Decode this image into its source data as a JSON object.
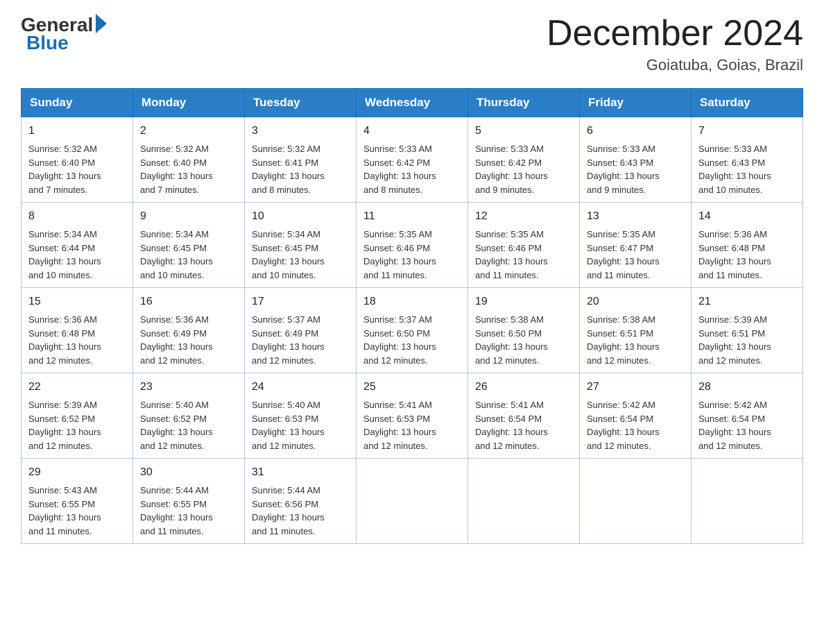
{
  "header": {
    "logo": {
      "general": "General",
      "blue": "Blue"
    },
    "title": "December 2024",
    "location": "Goiatuba, Goias, Brazil"
  },
  "calendar": {
    "days_of_week": [
      "Sunday",
      "Monday",
      "Tuesday",
      "Wednesday",
      "Thursday",
      "Friday",
      "Saturday"
    ],
    "weeks": [
      [
        {
          "day": "1",
          "sunrise": "5:32 AM",
          "sunset": "6:40 PM",
          "daylight": "13 hours and 7 minutes."
        },
        {
          "day": "2",
          "sunrise": "5:32 AM",
          "sunset": "6:40 PM",
          "daylight": "13 hours and 7 minutes."
        },
        {
          "day": "3",
          "sunrise": "5:32 AM",
          "sunset": "6:41 PM",
          "daylight": "13 hours and 8 minutes."
        },
        {
          "day": "4",
          "sunrise": "5:33 AM",
          "sunset": "6:42 PM",
          "daylight": "13 hours and 8 minutes."
        },
        {
          "day": "5",
          "sunrise": "5:33 AM",
          "sunset": "6:42 PM",
          "daylight": "13 hours and 9 minutes."
        },
        {
          "day": "6",
          "sunrise": "5:33 AM",
          "sunset": "6:43 PM",
          "daylight": "13 hours and 9 minutes."
        },
        {
          "day": "7",
          "sunrise": "5:33 AM",
          "sunset": "6:43 PM",
          "daylight": "13 hours and 10 minutes."
        }
      ],
      [
        {
          "day": "8",
          "sunrise": "5:34 AM",
          "sunset": "6:44 PM",
          "daylight": "13 hours and 10 minutes."
        },
        {
          "day": "9",
          "sunrise": "5:34 AM",
          "sunset": "6:45 PM",
          "daylight": "13 hours and 10 minutes."
        },
        {
          "day": "10",
          "sunrise": "5:34 AM",
          "sunset": "6:45 PM",
          "daylight": "13 hours and 10 minutes."
        },
        {
          "day": "11",
          "sunrise": "5:35 AM",
          "sunset": "6:46 PM",
          "daylight": "13 hours and 11 minutes."
        },
        {
          "day": "12",
          "sunrise": "5:35 AM",
          "sunset": "6:46 PM",
          "daylight": "13 hours and 11 minutes."
        },
        {
          "day": "13",
          "sunrise": "5:35 AM",
          "sunset": "6:47 PM",
          "daylight": "13 hours and 11 minutes."
        },
        {
          "day": "14",
          "sunrise": "5:36 AM",
          "sunset": "6:48 PM",
          "daylight": "13 hours and 11 minutes."
        }
      ],
      [
        {
          "day": "15",
          "sunrise": "5:36 AM",
          "sunset": "6:48 PM",
          "daylight": "13 hours and 12 minutes."
        },
        {
          "day": "16",
          "sunrise": "5:36 AM",
          "sunset": "6:49 PM",
          "daylight": "13 hours and 12 minutes."
        },
        {
          "day": "17",
          "sunrise": "5:37 AM",
          "sunset": "6:49 PM",
          "daylight": "13 hours and 12 minutes."
        },
        {
          "day": "18",
          "sunrise": "5:37 AM",
          "sunset": "6:50 PM",
          "daylight": "13 hours and 12 minutes."
        },
        {
          "day": "19",
          "sunrise": "5:38 AM",
          "sunset": "6:50 PM",
          "daylight": "13 hours and 12 minutes."
        },
        {
          "day": "20",
          "sunrise": "5:38 AM",
          "sunset": "6:51 PM",
          "daylight": "13 hours and 12 minutes."
        },
        {
          "day": "21",
          "sunrise": "5:39 AM",
          "sunset": "6:51 PM",
          "daylight": "13 hours and 12 minutes."
        }
      ],
      [
        {
          "day": "22",
          "sunrise": "5:39 AM",
          "sunset": "6:52 PM",
          "daylight": "13 hours and 12 minutes."
        },
        {
          "day": "23",
          "sunrise": "5:40 AM",
          "sunset": "6:52 PM",
          "daylight": "13 hours and 12 minutes."
        },
        {
          "day": "24",
          "sunrise": "5:40 AM",
          "sunset": "6:53 PM",
          "daylight": "13 hours and 12 minutes."
        },
        {
          "day": "25",
          "sunrise": "5:41 AM",
          "sunset": "6:53 PM",
          "daylight": "13 hours and 12 minutes."
        },
        {
          "day": "26",
          "sunrise": "5:41 AM",
          "sunset": "6:54 PM",
          "daylight": "13 hours and 12 minutes."
        },
        {
          "day": "27",
          "sunrise": "5:42 AM",
          "sunset": "6:54 PM",
          "daylight": "13 hours and 12 minutes."
        },
        {
          "day": "28",
          "sunrise": "5:42 AM",
          "sunset": "6:54 PM",
          "daylight": "13 hours and 12 minutes."
        }
      ],
      [
        {
          "day": "29",
          "sunrise": "5:43 AM",
          "sunset": "6:55 PM",
          "daylight": "13 hours and 11 minutes."
        },
        {
          "day": "30",
          "sunrise": "5:44 AM",
          "sunset": "6:55 PM",
          "daylight": "13 hours and 11 minutes."
        },
        {
          "day": "31",
          "sunrise": "5:44 AM",
          "sunset": "6:56 PM",
          "daylight": "13 hours and 11 minutes."
        },
        null,
        null,
        null,
        null
      ]
    ],
    "labels": {
      "sunrise": "Sunrise:",
      "sunset": "Sunset:",
      "daylight": "Daylight:"
    }
  }
}
